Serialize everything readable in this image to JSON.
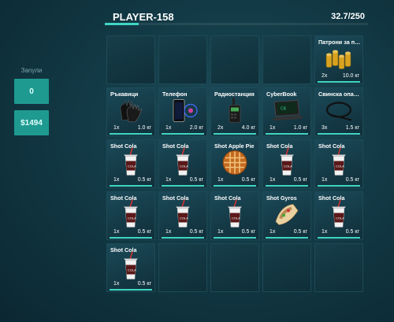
{
  "header": {
    "player": "PLAYER-158",
    "weight": "32.7/250",
    "capacity_fraction": 0.13
  },
  "left": {
    "ammo_label": "Заnули",
    "ammo_value": "0",
    "money": "$1494"
  },
  "slots": [
    {},
    {},
    {},
    {},
    {
      "name": "Патрони за пис...",
      "qty": "2x",
      "weight": "10.0 кг",
      "icon": "ammo-icon"
    },
    {
      "name": "Ръкавици",
      "qty": "1x",
      "weight": "1.0 кг",
      "icon": "gloves-icon"
    },
    {
      "name": "Телефон",
      "qty": "1x",
      "weight": "2.0 кг",
      "icon": "phone-icon"
    },
    {
      "name": "Радиостанция",
      "qty": "2x",
      "weight": "4.0 кг",
      "icon": "radio-icon"
    },
    {
      "name": "CyberBook",
      "qty": "1x",
      "weight": "1.0 кг",
      "icon": "laptop-icon"
    },
    {
      "name": "Свинска опашка",
      "qty": "3x",
      "weight": "1.5 кг",
      "icon": "zip-tie-icon"
    },
    {
      "name": "Shot Cola",
      "qty": "1x",
      "weight": "0.5 кг",
      "icon": "cola-cup-icon"
    },
    {
      "name": "Shot Cola",
      "qty": "1x",
      "weight": "0.5 кг",
      "icon": "cola-cup-icon"
    },
    {
      "name": "Shot Apple Pie",
      "qty": "1x",
      "weight": "0.5 кг",
      "icon": "pie-icon"
    },
    {
      "name": "Shot Cola",
      "qty": "1x",
      "weight": "0.5 кг",
      "icon": "cola-cup-icon"
    },
    {
      "name": "Shot Cola",
      "qty": "1x",
      "weight": "0.5 кг",
      "icon": "cola-cup-icon"
    },
    {
      "name": "Shot Cola",
      "qty": "1x",
      "weight": "0.5 кг",
      "icon": "cola-cup-icon"
    },
    {
      "name": "Shot Cola",
      "qty": "1x",
      "weight": "0.5 кг",
      "icon": "cola-cup-icon"
    },
    {
      "name": "Shot Cola",
      "qty": "1x",
      "weight": "0.5 кг",
      "icon": "cola-cup-icon"
    },
    {
      "name": "Shot Gyros",
      "qty": "1x",
      "weight": "0.5 кг",
      "icon": "gyros-icon"
    },
    {
      "name": "Shot Cola",
      "qty": "1x",
      "weight": "0.5 кг",
      "icon": "cola-cup-icon"
    },
    {
      "name": "Shot Cola",
      "qty": "1x",
      "weight": "0.5 кг",
      "icon": "cola-cup-icon"
    },
    {},
    {},
    {},
    {}
  ]
}
